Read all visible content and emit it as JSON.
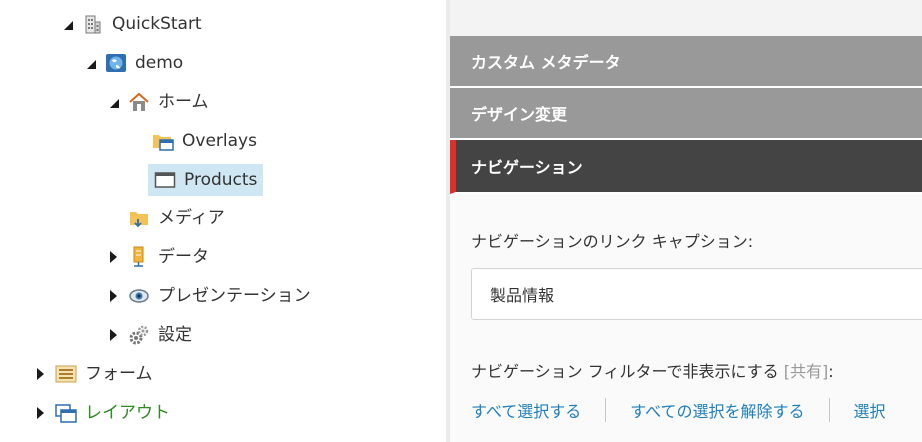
{
  "tree": {
    "nodes": [
      {
        "label": "QuickStart",
        "icon": "building-icon",
        "state": "expanded"
      },
      {
        "label": "demo",
        "icon": "globe-icon",
        "state": "expanded"
      },
      {
        "label": "ホーム",
        "icon": "home-icon",
        "state": "expanded"
      },
      {
        "label": "Overlays",
        "icon": "overlays-folder-icon",
        "state": "leaf"
      },
      {
        "label": "Products",
        "icon": "window-icon",
        "state": "leaf",
        "selected": true
      },
      {
        "label": "メディア",
        "icon": "media-folder-icon",
        "state": "leaf"
      },
      {
        "label": "データ",
        "icon": "database-icon",
        "state": "collapsed"
      },
      {
        "label": "プレゼンテーション",
        "icon": "eye-icon",
        "state": "collapsed"
      },
      {
        "label": "設定",
        "icon": "gears-icon",
        "state": "collapsed"
      },
      {
        "label": "フォーム",
        "icon": "form-icon",
        "state": "collapsed"
      },
      {
        "label": "レイアウト",
        "icon": "layout-icon",
        "state": "collapsed"
      }
    ]
  },
  "panel": {
    "sections": {
      "custom_metadata": "カスタム メタデータ",
      "design_change": "デザイン変更",
      "navigation": "ナビゲーション"
    },
    "nav_caption_label": "ナビゲーションのリンク キャプション:",
    "nav_caption_value": "製品情報",
    "nav_filter_label": "ナビゲーション フィルターで非表示にする",
    "nav_filter_shared": "[共有]",
    "nav_filter_colon": ":",
    "links": {
      "select_all": "すべて選択する",
      "deselect_all": "すべての選択を解除する",
      "invert": "選択"
    }
  },
  "colors": {
    "section_bg": "#999999",
    "active_section_bg": "#444444",
    "active_marker": "#d9302a",
    "link": "#1f7fbf",
    "selection_bg": "#cfe6f3",
    "layout_label": "#2e8b1f"
  }
}
